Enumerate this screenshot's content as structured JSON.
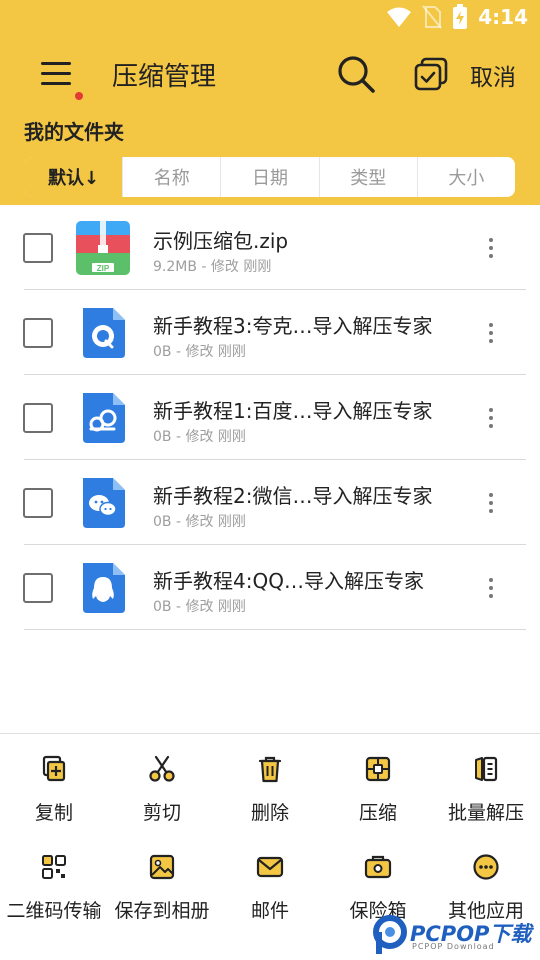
{
  "status": {
    "time": "4:14"
  },
  "toolbar": {
    "title": "压缩管理",
    "cancel_label": "取消"
  },
  "folder": {
    "title": "我的文件夹"
  },
  "sort_tabs": [
    {
      "label": "默认↓",
      "active": true
    },
    {
      "label": "名称",
      "active": false
    },
    {
      "label": "日期",
      "active": false
    },
    {
      "label": "类型",
      "active": false
    },
    {
      "label": "大小",
      "active": false
    }
  ],
  "files": [
    {
      "name": "示例压缩包.zip",
      "meta": "9.2MB - 修改 刚刚",
      "icon": "zip-archive-icon"
    },
    {
      "name": "新手教程3:夸克…导入解压专家",
      "meta": "0B - 修改 刚刚",
      "icon": "quark-doc-icon"
    },
    {
      "name": "新手教程1:百度…导入解压专家",
      "meta": "0B - 修改 刚刚",
      "icon": "baidu-cloud-doc-icon"
    },
    {
      "name": "新手教程2:微信…导入解压专家",
      "meta": "0B - 修改 刚刚",
      "icon": "wechat-doc-icon"
    },
    {
      "name": "新手教程4:QQ…导入解压专家",
      "meta": "0B - 修改 刚刚",
      "icon": "qq-doc-icon"
    }
  ],
  "actions": [
    {
      "label": "复制",
      "icon": "copy-icon"
    },
    {
      "label": "剪切",
      "icon": "scissors-icon"
    },
    {
      "label": "删除",
      "icon": "trash-icon"
    },
    {
      "label": "压缩",
      "icon": "compress-icon"
    },
    {
      "label": "批量解压",
      "icon": "batch-extract-icon"
    },
    {
      "label": "二维码传输",
      "icon": "qr-code-icon"
    },
    {
      "label": "保存到相册",
      "icon": "image-icon"
    },
    {
      "label": "邮件",
      "icon": "mail-icon"
    },
    {
      "label": "保险箱",
      "icon": "safe-box-icon"
    },
    {
      "label": "其他应用",
      "icon": "more-apps-icon"
    }
  ],
  "watermark": {
    "brand": "PCPOP下载",
    "sub": "PCPOP Download"
  },
  "colors": {
    "accent": "#F3C744",
    "icon_blue": "#2F7DE1",
    "zip_red": "#E8505B",
    "zip_green": "#5CC06B"
  }
}
